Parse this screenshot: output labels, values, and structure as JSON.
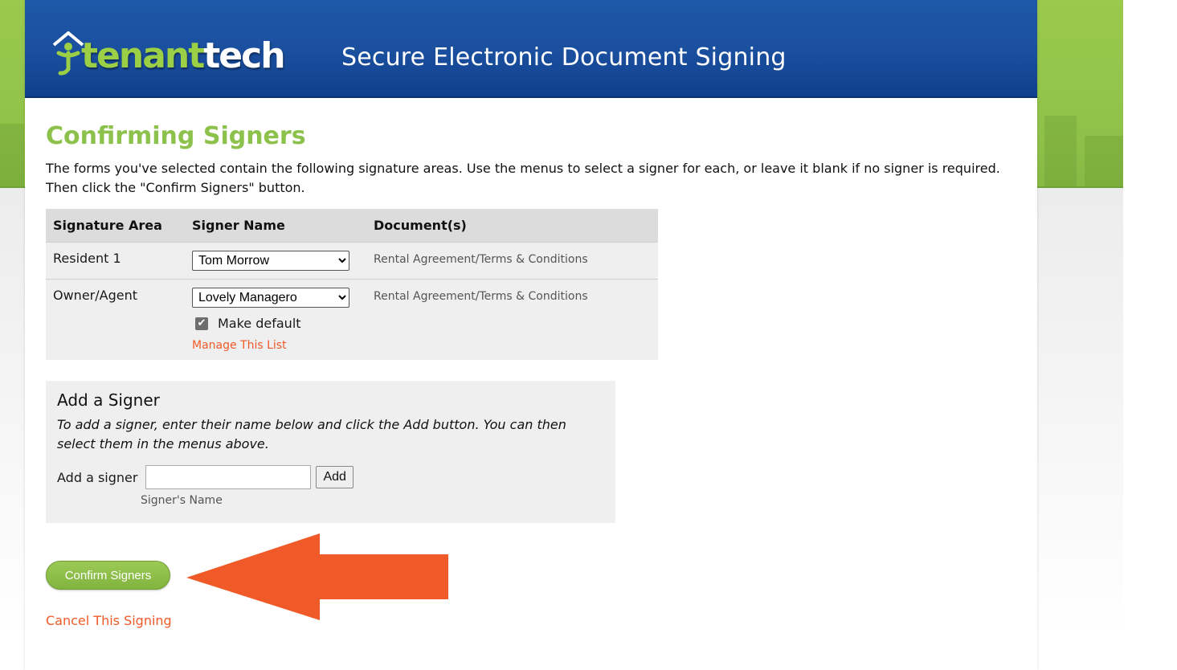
{
  "header": {
    "logo_word_a": "tenant",
    "logo_word_b": "tech",
    "title": "Secure Electronic Document Signing"
  },
  "page": {
    "title": "Confirming Signers",
    "intro": "The forms you've selected contain the following signature areas. Use the menus to select a signer for each, or leave it blank if no signer is required. Then click the \"Confirm Signers\" button."
  },
  "table": {
    "headers": [
      "Signature Area",
      "Signer Name",
      "Document(s)"
    ],
    "rows": [
      {
        "area": "Resident 1",
        "signer": "Tom Morrow",
        "documents": "Rental Agreement/Terms & Conditions"
      },
      {
        "area": "Owner/Agent",
        "signer": "Lovely Managero",
        "documents": "Rental Agreement/Terms & Conditions"
      }
    ],
    "make_default_label": "Make default",
    "make_default_checked": true,
    "manage_link": "Manage This List"
  },
  "add_signer": {
    "heading": "Add a Signer",
    "help": "To add a signer, enter their name below and click the Add button. You can then select them in the menus above.",
    "label": "Add a signer",
    "input_value": "",
    "button": "Add",
    "caption": "Signer's Name"
  },
  "actions": {
    "confirm": "Confirm Signers",
    "cancel": "Cancel This Signing"
  },
  "colors": {
    "brand_green": "#8cc14b",
    "header_blue": "#1a4f9e",
    "link_orange": "#f05a28",
    "arrow_orange": "#f05a28"
  },
  "icons": {
    "logo": "house-person-icon",
    "select_caret": "chevron-down-icon",
    "checkbox": "checkmark-icon",
    "annotation": "left-arrow-icon"
  }
}
